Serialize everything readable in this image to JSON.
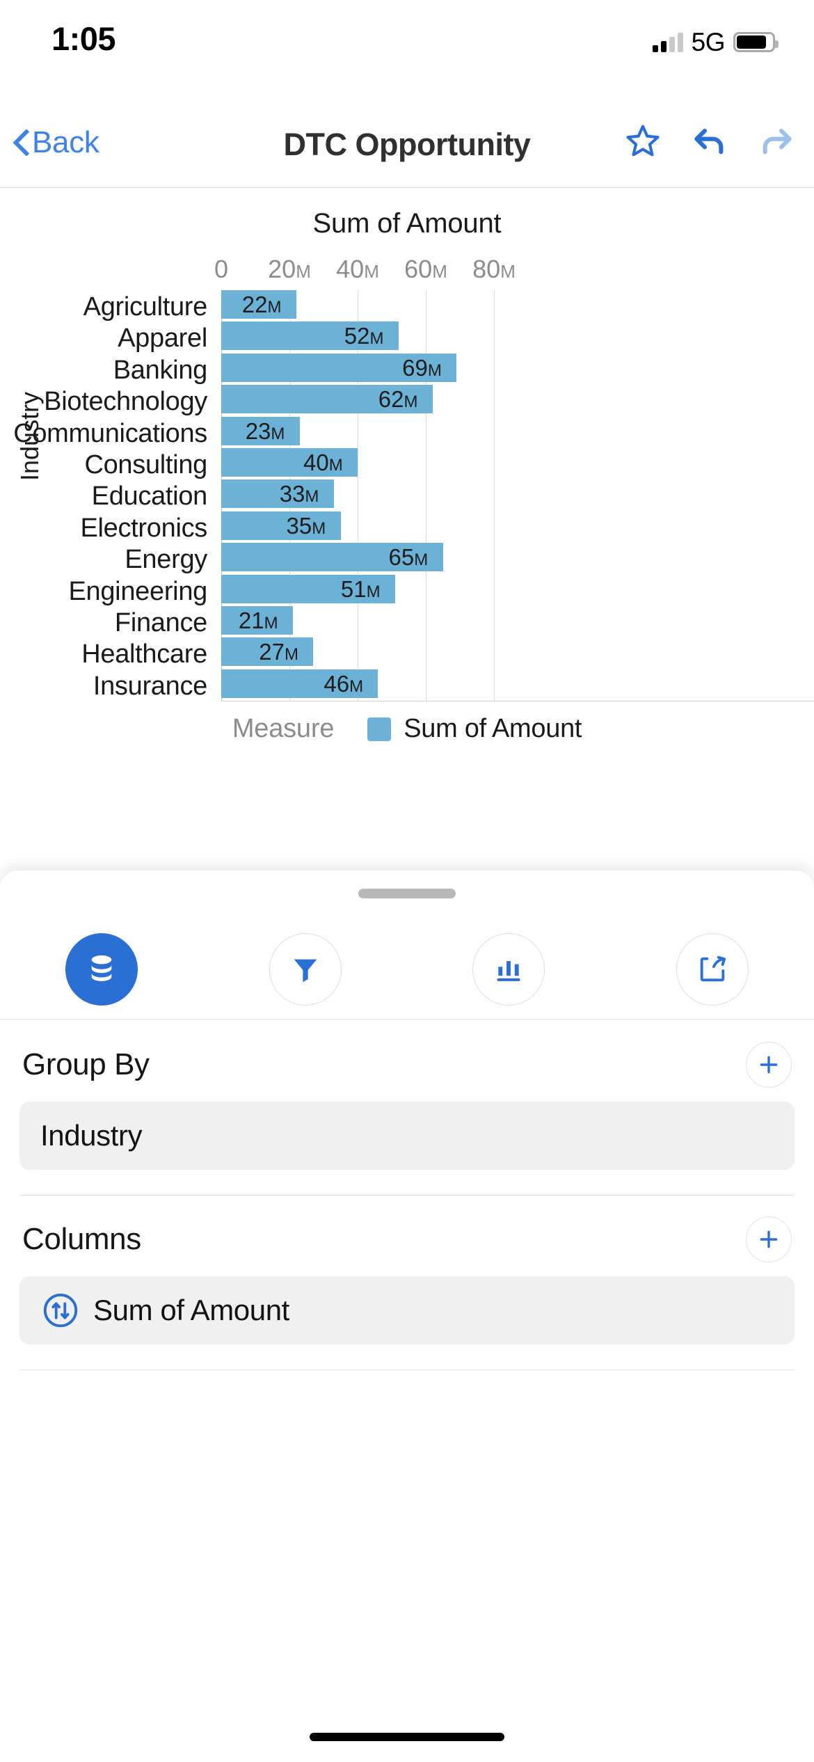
{
  "status_bar": {
    "time": "1:05",
    "network": "5G",
    "signal_bars_filled": 2,
    "signal_bars_total": 4,
    "battery_level_pct": 84
  },
  "nav_bar": {
    "back_label": "Back",
    "title": "DTC Opportunity",
    "actions": [
      {
        "name": "favorite-icon",
        "label": "Favorite",
        "state": "outline",
        "color": "#2a6fd4"
      },
      {
        "name": "undo-icon",
        "label": "Undo",
        "state": "enabled",
        "color": "#2a6fd4"
      },
      {
        "name": "redo-icon",
        "label": "Redo",
        "state": "disabled",
        "color": "#9dc0ea"
      }
    ]
  },
  "chart_data": {
    "type": "bar",
    "orientation": "horizontal",
    "title": "Sum of Amount",
    "xlabel": "",
    "ylabel": "Industry",
    "xlim": [
      0,
      87
    ],
    "xticks": [
      0,
      20,
      40,
      60,
      80
    ],
    "xtick_labels": [
      "0",
      "20M",
      "40M",
      "60M",
      "80M"
    ],
    "unit_suffix": "M",
    "grid": true,
    "bar_color": "#6cb1d6",
    "legend": {
      "position": "bottom",
      "title": "Measure",
      "entries": [
        "Sum of Amount"
      ]
    },
    "categories": [
      "Agriculture",
      "Apparel",
      "Banking",
      "Biotechnology",
      "Communications",
      "Consulting",
      "Education",
      "Electronics",
      "Energy",
      "Engineering",
      "Finance",
      "Healthcare",
      "Insurance"
    ],
    "values": [
      22,
      52,
      69,
      62,
      23,
      40,
      33,
      35,
      65,
      51,
      21,
      27,
      46
    ],
    "value_labels": [
      "22M",
      "52M",
      "69M",
      "62M",
      "23M",
      "40M",
      "33M",
      "35M",
      "65M",
      "51M",
      "21M",
      "27M",
      "46M"
    ],
    "series": [
      {
        "name": "Sum of Amount",
        "values": [
          22,
          52,
          69,
          62,
          23,
          40,
          33,
          35,
          65,
          51,
          21,
          27,
          46
        ]
      }
    ],
    "note": "Last category (Insurance) is clipped at the bottom edge of the visible plot area"
  },
  "sheet": {
    "toolbar": [
      {
        "name": "data-icon",
        "label": "Data",
        "active": true
      },
      {
        "name": "filter-icon",
        "label": "Filter",
        "active": false
      },
      {
        "name": "chart-icon",
        "label": "Chart",
        "active": false
      },
      {
        "name": "share-icon",
        "label": "Share",
        "active": false
      }
    ],
    "sections": [
      {
        "title": "Group By",
        "add_label": "+",
        "items": [
          {
            "label": "Industry",
            "icon": null
          }
        ]
      },
      {
        "title": "Columns",
        "add_label": "+",
        "items": [
          {
            "label": "Sum of Amount",
            "icon": "sort-arrows-icon"
          }
        ]
      }
    ]
  },
  "colors": {
    "accent": "#2a6fd4",
    "link": "#3c82e8",
    "bar": "#6cb1d6",
    "muted_text": "#8c8c8c",
    "pill_bg": "#f0f0f0"
  }
}
